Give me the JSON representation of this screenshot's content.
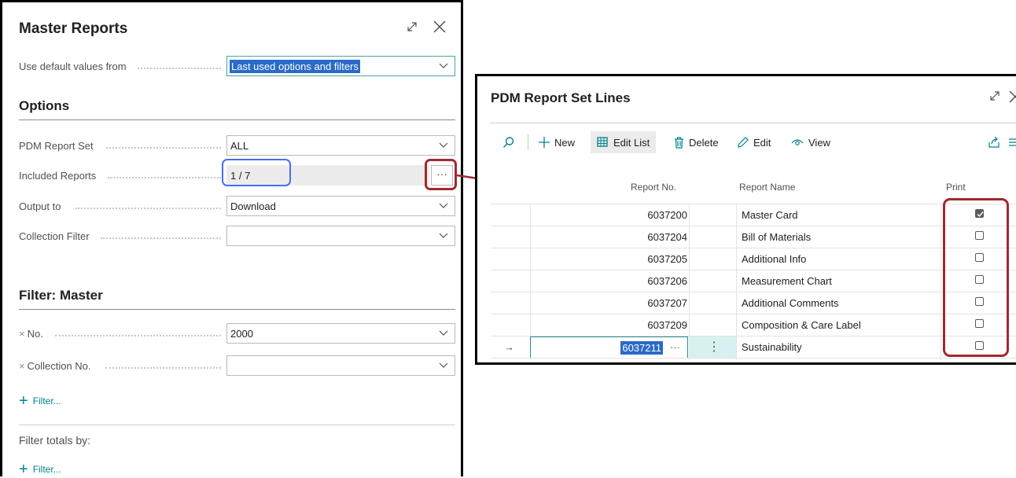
{
  "left_dialog": {
    "title": "Master Reports",
    "default_values": {
      "label": "Use default values from",
      "value": "Last used options and filters"
    },
    "options_title": "Options",
    "options": [
      {
        "label": "PDM Report Set",
        "value": "ALL"
      },
      {
        "label": "Included Reports",
        "value": "1 / 7"
      },
      {
        "label": "Output to",
        "value": "Download"
      },
      {
        "label": "Collection Filter",
        "value": ""
      }
    ],
    "assist_button": "···",
    "filter_title": "Filter: Master",
    "filters": [
      {
        "remove": "×",
        "label": "No.",
        "value": "2000"
      },
      {
        "remove": "×",
        "label": "Collection No.",
        "value": ""
      }
    ],
    "add_filter": "Filter...",
    "filter_totals_label": "Filter totals by:",
    "add_filter_totals": "Filter..."
  },
  "right_dialog": {
    "title": "PDM Report Set Lines",
    "toolbar": {
      "new": "New",
      "edit_list": "Edit List",
      "delete": "Delete",
      "edit": "Edit",
      "view": "View"
    },
    "columns": {
      "report_no": "Report No.",
      "report_name": "Report Name",
      "print": "Print"
    },
    "rows": [
      {
        "report_no": "6037200",
        "report_name": "Master Card",
        "print": true
      },
      {
        "report_no": "6037204",
        "report_name": "Bill of Materials",
        "print": false
      },
      {
        "report_no": "6037205",
        "report_name": "Additional Info",
        "print": false
      },
      {
        "report_no": "6037206",
        "report_name": "Measurement Chart",
        "print": false
      },
      {
        "report_no": "6037207",
        "report_name": "Additional Comments",
        "print": false
      },
      {
        "report_no": "6037209",
        "report_name": "Composition & Care Label",
        "print": false
      }
    ],
    "current_row": {
      "indicator": "→",
      "report_no": "6037211",
      "assist": "···",
      "menu": "⋮",
      "report_name": "Sustainability",
      "print": false
    }
  }
}
